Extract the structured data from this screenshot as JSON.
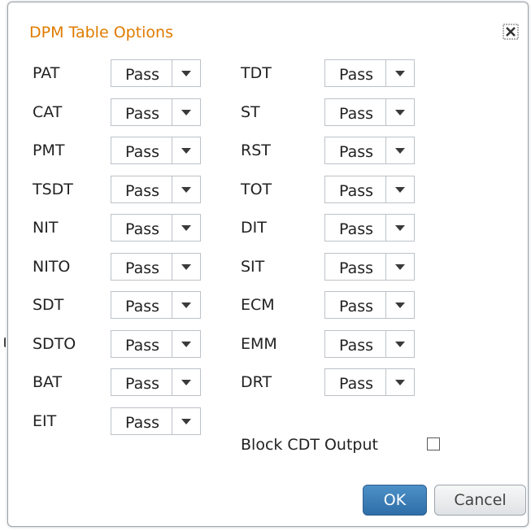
{
  "dialog": {
    "title": "DPM Table Options",
    "close_icon": "close-icon"
  },
  "left_column": [
    {
      "label": "PAT",
      "value": "Pass"
    },
    {
      "label": "CAT",
      "value": "Pass"
    },
    {
      "label": "PMT",
      "value": "Pass"
    },
    {
      "label": "TSDT",
      "value": "Pass"
    },
    {
      "label": "NIT",
      "value": "Pass"
    },
    {
      "label": "NITO",
      "value": "Pass"
    },
    {
      "label": "SDT",
      "value": "Pass"
    },
    {
      "label": "SDTO",
      "value": "Pass"
    },
    {
      "label": "BAT",
      "value": "Pass"
    },
    {
      "label": "EIT",
      "value": "Pass"
    }
  ],
  "right_column": [
    {
      "label": "TDT",
      "value": "Pass"
    },
    {
      "label": "ST",
      "value": "Pass"
    },
    {
      "label": "RST",
      "value": "Pass"
    },
    {
      "label": "TOT",
      "value": "Pass"
    },
    {
      "label": "DIT",
      "value": "Pass"
    },
    {
      "label": "SIT",
      "value": "Pass"
    },
    {
      "label": "ECM",
      "value": "Pass"
    },
    {
      "label": "EMM",
      "value": "Pass"
    },
    {
      "label": "DRT",
      "value": "Pass"
    }
  ],
  "block_cdt": {
    "label": "Block CDT Output",
    "checked": false
  },
  "buttons": {
    "ok": "OK",
    "cancel": "Cancel"
  },
  "colors": {
    "title": "#e07b00",
    "ok_button": "#3a7db8"
  }
}
